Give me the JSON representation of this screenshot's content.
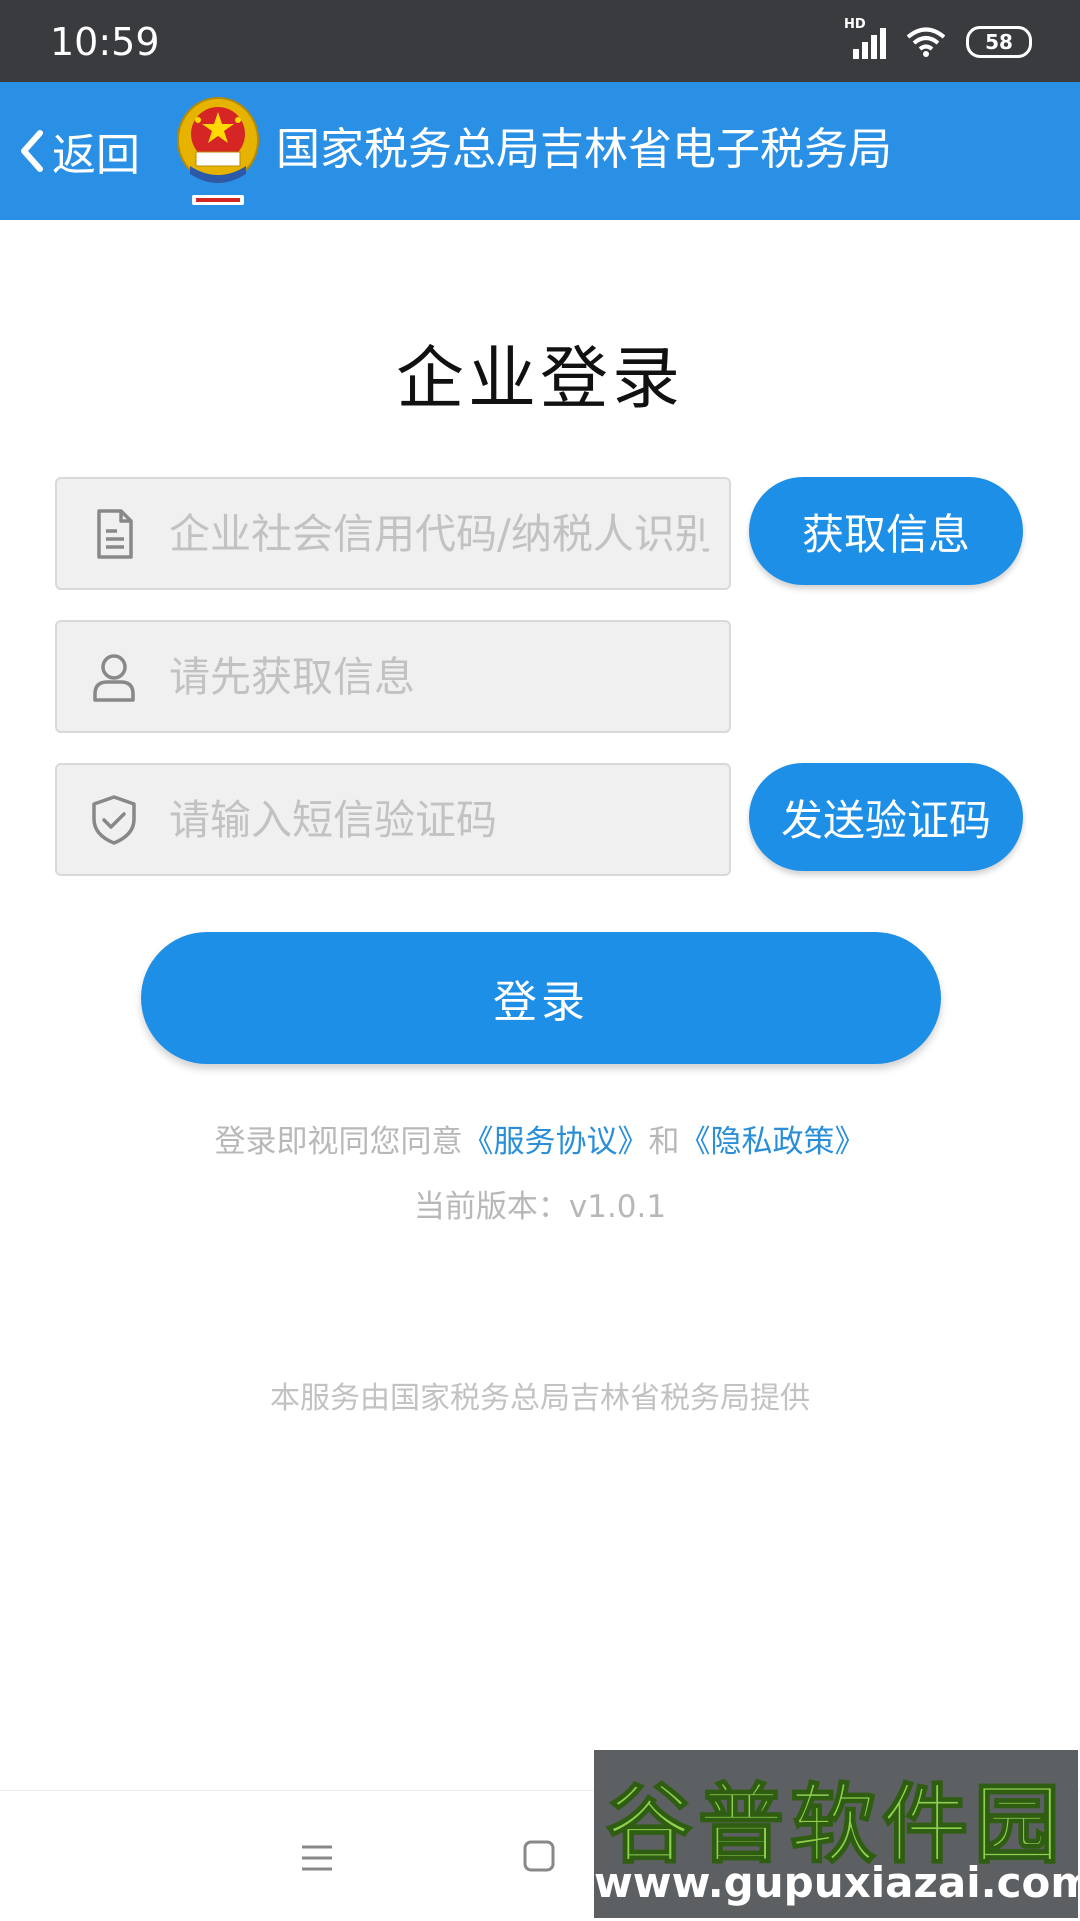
{
  "status_bar": {
    "time": "10:59",
    "network_label": "HD",
    "battery": "58"
  },
  "app_bar": {
    "back_label": "返回",
    "title": "国家税务总局吉林省电子税务局"
  },
  "page": {
    "title": "企业登录"
  },
  "form": {
    "tax_id": {
      "placeholder": "企业社会信用代码/纳税人识别号",
      "value": "",
      "icon": "document-icon"
    },
    "get_info_button": "获取信息",
    "user": {
      "placeholder": "请先获取信息",
      "value": "",
      "icon": "user-icon"
    },
    "sms_code": {
      "placeholder": "请输入短信验证码",
      "value": "",
      "icon": "shield-check-icon"
    },
    "send_code_button": "发送验证码",
    "login_button": "登录"
  },
  "footer": {
    "agreement_prefix": "登录即视同您同意",
    "service_agreement_link": "《服务协议》",
    "agreement_and": "和",
    "privacy_policy_link": "《隐私政策》",
    "version": "当前版本：v1.0.1",
    "provider": "本服务由国家税务总局吉林省税务局提供"
  },
  "watermark": {
    "logo_text": "谷普软件园",
    "url": "www.gupuxiazai.com"
  },
  "colors": {
    "primary": "#1e8fe7",
    "app_bar": "#2a90e6",
    "status_bar": "#3a3b3e",
    "link": "#2a8fd8",
    "placeholder": "#c2c2c2"
  }
}
